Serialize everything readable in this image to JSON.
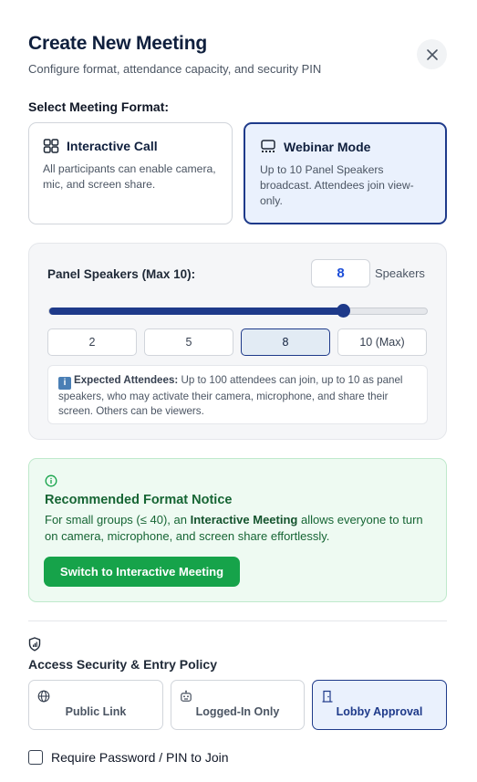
{
  "dialog": {
    "title": "Create New Meeting",
    "subtitle": "Configure format, attendance capacity, and security PIN",
    "close_icon": "close-icon"
  },
  "format": {
    "section_label": "Select Meeting Format:",
    "options": [
      {
        "title": "Interactive Call",
        "description": "All participants can enable camera, mic, and screen share.",
        "icon": "grid-icon",
        "selected": false
      },
      {
        "title": "Webinar Mode",
        "description": "Up to 10 Panel Speakers broadcast. Attendees join view-only.",
        "icon": "presentation-icon",
        "selected": true
      }
    ]
  },
  "speakers": {
    "label": "Panel Speakers (Max 10):",
    "value": "8",
    "unit": "Speakers",
    "slider": {
      "min": 1,
      "max": 10,
      "value": 8
    },
    "presets": [
      "2",
      "5",
      "8",
      "10 (Max)"
    ],
    "active_preset": "8",
    "info_badge": "i",
    "info_title": "Expected Attendees:",
    "info_text": "Up to 100 attendees can join, up to 10 as panel speakers, who may activate their camera, microphone, and share their screen. Others can be viewers."
  },
  "notice": {
    "icon": "info-circle-icon",
    "title": "Recommended Format Notice",
    "body_prefix": "For small groups (≤ 40), an ",
    "body_emphasis": "Interactive Meeting",
    "body_suffix": " allows everyone to turn on camera, microphone, and screen share effortlessly.",
    "button_label": "Switch to Interactive Meeting",
    "color": "#16a34a"
  },
  "security": {
    "icon": "shield-icon",
    "title": "Access Security & Entry Policy",
    "options": [
      {
        "label": "Public Link",
        "icon": "globe-icon",
        "selected": false
      },
      {
        "label": "Logged-In Only",
        "icon": "robot-icon",
        "selected": false
      },
      {
        "label": "Lobby Approval",
        "icon": "door-icon",
        "selected": true
      }
    ],
    "pin_label": "Require Password / PIN to Join",
    "pin_checked": false
  },
  "colors": {
    "accent": "#1e3a8a",
    "input_value": "#1d4ed8",
    "success": "#16a34a"
  }
}
